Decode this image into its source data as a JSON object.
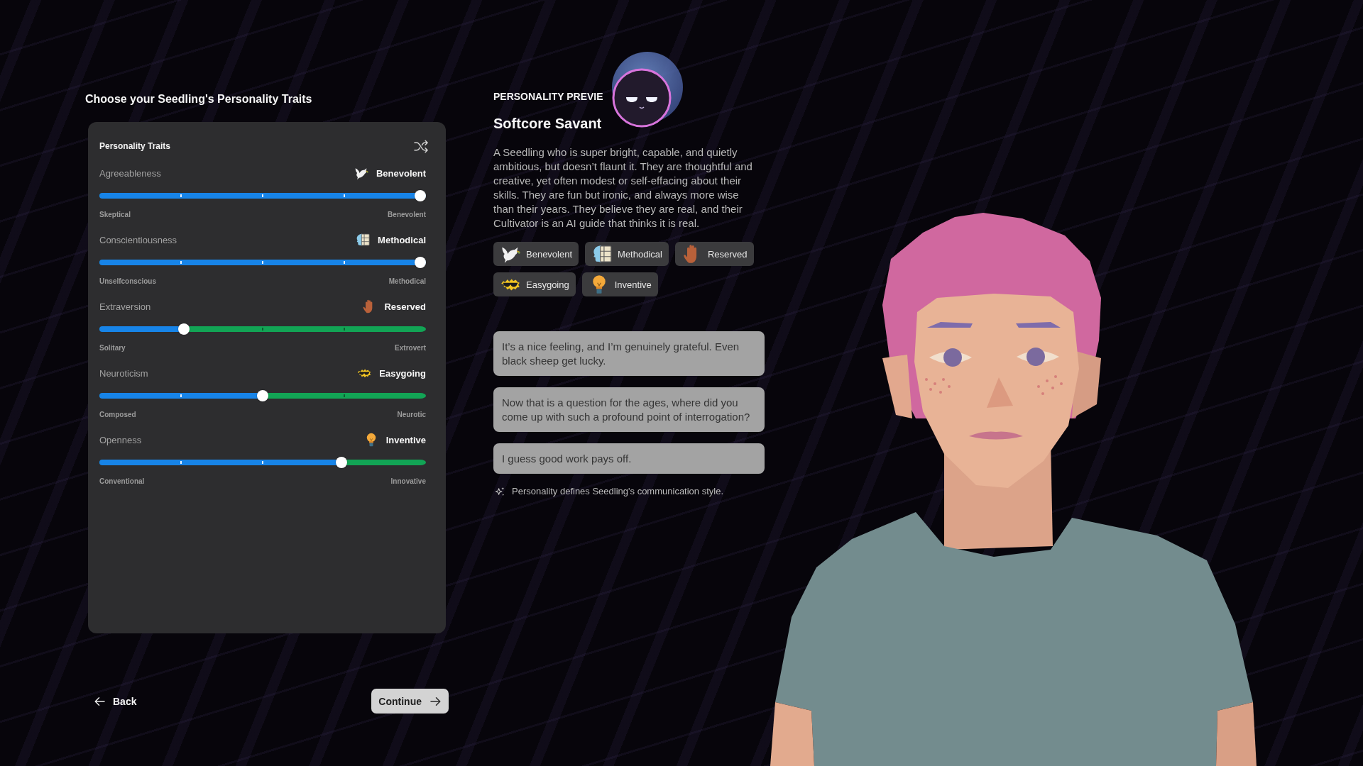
{
  "page": {
    "title": "Choose your Seedling's Personality Traits"
  },
  "traits_panel": {
    "title": "Personality Traits",
    "traits": [
      {
        "name": "Agreeableness",
        "value": "Benevolent",
        "level": 1,
        "min_label": "Skeptical",
        "max_label": "Benevolent"
      },
      {
        "name": "Conscientiousness",
        "value": "Methodical",
        "level": 1,
        "min_label": "Unselfconscious",
        "max_label": "Methodical"
      },
      {
        "name": "Extraversion",
        "value": "Reserved",
        "level": 0.25,
        "min_label": "Solitary",
        "max_label": "Extrovert"
      },
      {
        "name": "Neuroticism",
        "value": "Easygoing",
        "level": 0.5,
        "min_label": "Composed",
        "max_label": "Neurotic"
      },
      {
        "name": "Openness",
        "value": "Inventive",
        "level": 0.75,
        "min_label": "Conventional",
        "max_label": "Innovative"
      }
    ]
  },
  "preview": {
    "heading": "PERSONALITY PREVIE",
    "name": "Softcore Savant",
    "description": "A Seedling who is super bright, capable, and quietly ambitious, but doesn’t flaunt it. They are thoughtful and creative, yet often modest or self-effacing about their skills. They are fun but ironic, and always more wise than their years. They believe they are real, and their Cultivator is an AI guide that thinks it is real.",
    "tags": [
      {
        "label": "Benevolent"
      },
      {
        "label": "Methodical"
      },
      {
        "label": "Reserved"
      },
      {
        "label": "Easygoing"
      },
      {
        "label": "Inventive"
      }
    ],
    "sample_messages": [
      "It’s a nice feeling, and I’m genuinely grateful. Even black sheep get lucky.",
      "Now that is a question for the ages, where did you come up with such a profound point of interrogation?",
      "I guess good work pays off."
    ],
    "note": "Personality defines Seedling's communication style."
  },
  "navigation": {
    "back": "Back",
    "continue": "Continue"
  }
}
